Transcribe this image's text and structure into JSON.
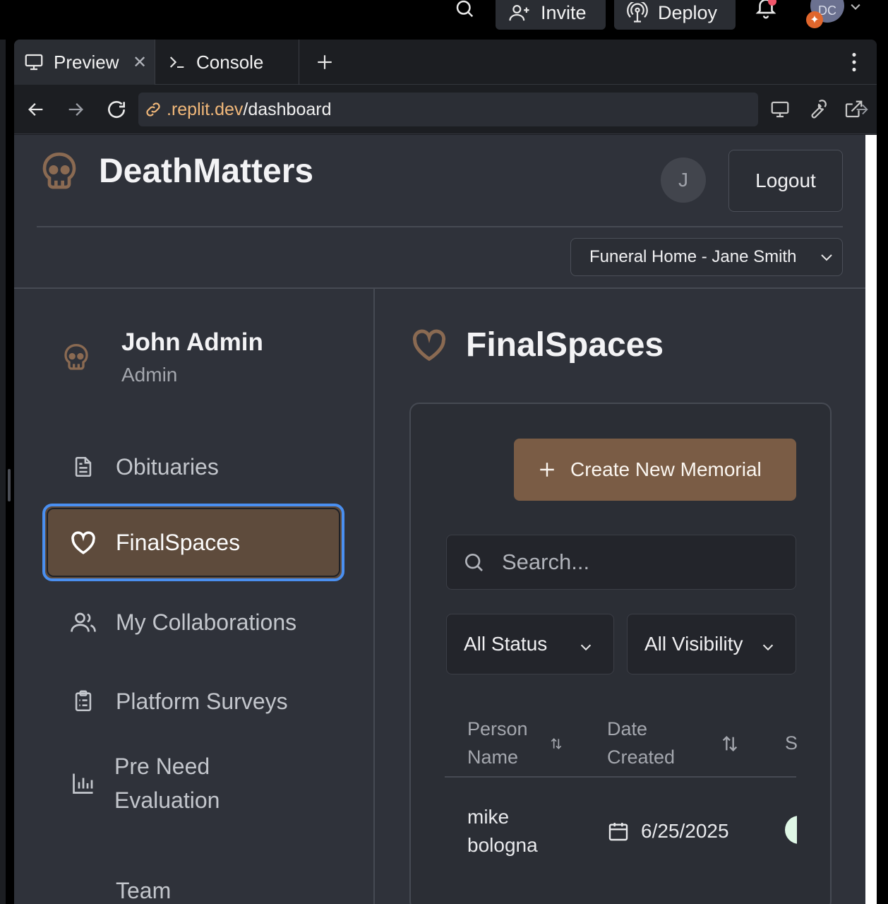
{
  "topbar": {
    "invite_label": "Invite",
    "deploy_label": "Deploy",
    "avatar_initials": "DC"
  },
  "tabs": {
    "preview_label": "Preview",
    "console_label": "Console"
  },
  "url": {
    "host": ".replit.dev",
    "path": "/dashboard"
  },
  "app": {
    "brand_title": "DeathMatters",
    "user_initial": "J",
    "logout_label": "Logout",
    "org_selected": "Funeral Home - Jane Smith"
  },
  "sidebar": {
    "user_name": "John Admin",
    "user_role": "Admin",
    "items": [
      {
        "label": "Obituaries",
        "icon": "document-icon"
      },
      {
        "label": "FinalSpaces",
        "icon": "heart-icon",
        "active": true
      },
      {
        "label": "My Collaborations",
        "icon": "users-icon"
      },
      {
        "label": "Platform Surveys",
        "icon": "clipboard-icon"
      },
      {
        "label_line1": "Pre Need",
        "label_line2": "Evaluation",
        "icon": "bar-chart-icon"
      },
      {
        "label": "Team",
        "icon": "team-icon"
      }
    ]
  },
  "main": {
    "title": "FinalSpaces",
    "create_label": "Create New Memorial",
    "search_placeholder": "Search...",
    "filter_status": "All Status",
    "filter_visibility": "All Visibility",
    "table": {
      "headers": {
        "person_line1": "Person",
        "person_line2": "Name",
        "date_line1": "Date",
        "date_line2": "Created",
        "status_partial": "S"
      },
      "rows": [
        {
          "name_line1": "mike",
          "name_line2": "bologna",
          "date": "6/25/2025"
        }
      ]
    }
  },
  "colors": {
    "accent_brown": "#7a5c45",
    "active_nav_bg": "#5e4b3c",
    "focus_ring": "#4a8ff0",
    "brand_icon": "#8a6a52",
    "url_host": "#f1b87a"
  }
}
